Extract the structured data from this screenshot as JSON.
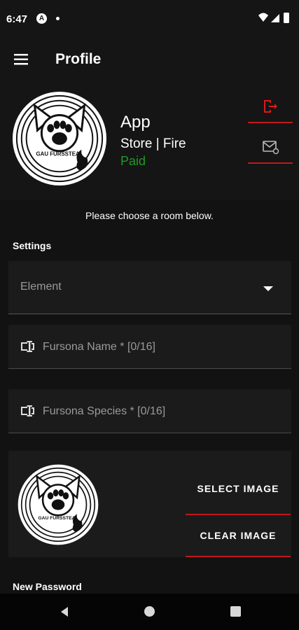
{
  "status_bar": {
    "time": "6:47",
    "app_badge": "A"
  },
  "app_bar": {
    "title": "Profile",
    "menu_icon": "hamburger-menu-icon"
  },
  "profile": {
    "app_name": "App",
    "store_line": "Store | Fire",
    "payment_status": "Paid",
    "avatar_text": "GAU FURSSTEAL",
    "logout_icon": "logout-icon",
    "mail_icon": "mail-settings-icon"
  },
  "instruction": "Please choose a room below.",
  "settings": {
    "label": "Settings",
    "element_select": {
      "value": "Element"
    },
    "fursona_name": {
      "placeholder": "Fursona Name * [0/16]"
    },
    "fursona_species": {
      "placeholder": "Fursona Species * [0/16]"
    }
  },
  "image": {
    "select_label": "SELECT IMAGE",
    "clear_label": "CLEAR IMAGE"
  },
  "password": {
    "label": "New Password"
  },
  "colors": {
    "accent_red": "#c0171c",
    "paid_green": "#1e9a26",
    "background": "#121212",
    "surface": "#1b1b1b"
  }
}
